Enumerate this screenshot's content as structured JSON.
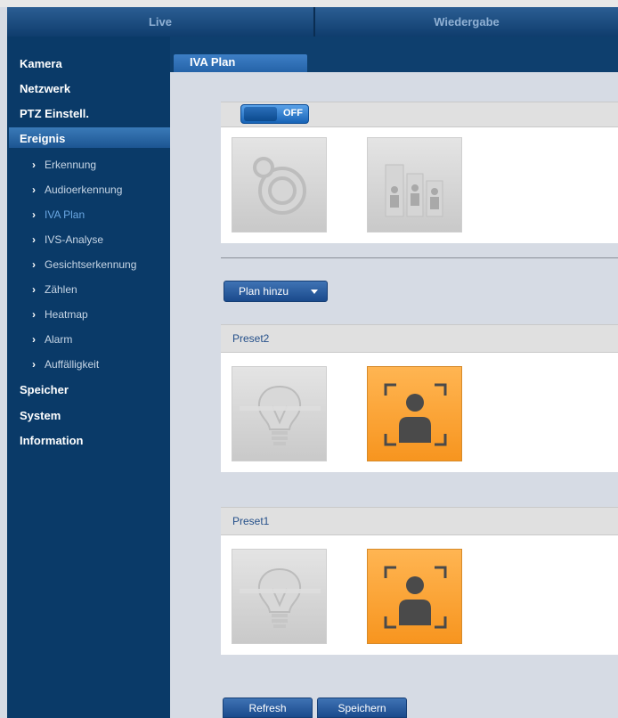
{
  "topnav": {
    "live": "Live",
    "playback": "Wiedergabe"
  },
  "main_tab": "IVA Plan",
  "sidebar": {
    "items": [
      "Kamera",
      "Netzwerk",
      "PTZ Einstell.",
      "Ereignis"
    ],
    "sub_items": [
      "Erkennung",
      "Audioerkennung",
      "IVA Plan",
      "IVS-Analyse",
      "Gesichtserkennung",
      "Zählen",
      "Heatmap",
      "Alarm",
      "Auffälligkeit"
    ],
    "bottom_items": [
      "Speicher",
      "System",
      "Information"
    ]
  },
  "toggle": {
    "label": "OFF"
  },
  "plan_button": "Plan hinzu",
  "presets": [
    "Preset2",
    "Preset1"
  ],
  "footer": {
    "refresh": "Refresh",
    "save": "Speichern"
  },
  "colors": {
    "accent_orange": "#f7951f",
    "nav_blue": "#0a3a68"
  }
}
